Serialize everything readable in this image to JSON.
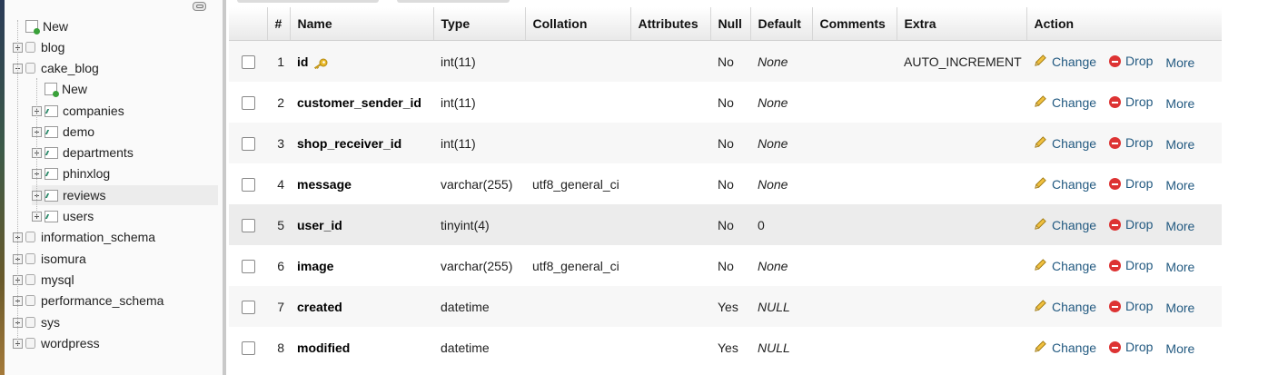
{
  "nav": {
    "items": [
      {
        "label": "New",
        "kind": "new",
        "level": 0
      },
      {
        "label": "blog",
        "kind": "db",
        "level": 0,
        "expander": "plus"
      },
      {
        "label": "cake_blog",
        "kind": "db",
        "level": 0,
        "expander": "minus"
      },
      {
        "label": "New",
        "kind": "new",
        "level": 1
      },
      {
        "label": "companies",
        "kind": "table",
        "level": 1,
        "expander": "plus"
      },
      {
        "label": "demo",
        "kind": "table",
        "level": 1,
        "expander": "plus"
      },
      {
        "label": "departments",
        "kind": "table",
        "level": 1,
        "expander": "plus"
      },
      {
        "label": "phinxlog",
        "kind": "table",
        "level": 1,
        "expander": "plus"
      },
      {
        "label": "reviews",
        "kind": "table",
        "level": 1,
        "expander": "plus",
        "selected": true
      },
      {
        "label": "users",
        "kind": "table",
        "level": 1,
        "expander": "plus"
      },
      {
        "label": "information_schema",
        "kind": "db",
        "level": 0,
        "expander": "plus"
      },
      {
        "label": "isomura",
        "kind": "db",
        "level": 0,
        "expander": "plus"
      },
      {
        "label": "mysql",
        "kind": "db",
        "level": 0,
        "expander": "plus"
      },
      {
        "label": "performance_schema",
        "kind": "db",
        "level": 0,
        "expander": "plus"
      },
      {
        "label": "sys",
        "kind": "db",
        "level": 0,
        "expander": "plus"
      },
      {
        "label": "wordpress",
        "kind": "db",
        "level": 0,
        "expander": "plus"
      }
    ]
  },
  "table": {
    "headers": {
      "num": "#",
      "name": "Name",
      "type": "Type",
      "collation": "Collation",
      "attributes": "Attributes",
      "null": "Null",
      "default": "Default",
      "comments": "Comments",
      "extra": "Extra",
      "action": "Action"
    },
    "action_labels": {
      "change": "Change",
      "drop": "Drop",
      "more": "More"
    },
    "rows": [
      {
        "num": "1",
        "name": "id",
        "type": "int(11)",
        "collation": "",
        "attributes": "",
        "null": "No",
        "default": "None",
        "default_italic": true,
        "comments": "",
        "extra": "AUTO_INCREMENT",
        "primary_key": true
      },
      {
        "num": "2",
        "name": "customer_sender_id",
        "type": "int(11)",
        "collation": "",
        "attributes": "",
        "null": "No",
        "default": "None",
        "default_italic": true,
        "comments": "",
        "extra": ""
      },
      {
        "num": "3",
        "name": "shop_receiver_id",
        "type": "int(11)",
        "collation": "",
        "attributes": "",
        "null": "No",
        "default": "None",
        "default_italic": true,
        "comments": "",
        "extra": ""
      },
      {
        "num": "4",
        "name": "message",
        "type": "varchar(255)",
        "collation": "utf8_general_ci",
        "attributes": "",
        "null": "No",
        "default": "None",
        "default_italic": true,
        "comments": "",
        "extra": ""
      },
      {
        "num": "5",
        "name": "user_id",
        "type": "tinyint(4)",
        "collation": "",
        "attributes": "",
        "null": "No",
        "default": "0",
        "default_italic": false,
        "comments": "",
        "extra": ""
      },
      {
        "num": "6",
        "name": "image",
        "type": "varchar(255)",
        "collation": "utf8_general_ci",
        "attributes": "",
        "null": "No",
        "default": "None",
        "default_italic": true,
        "comments": "",
        "extra": ""
      },
      {
        "num": "7",
        "name": "created",
        "type": "datetime",
        "collation": "",
        "attributes": "",
        "null": "Yes",
        "default": "NULL",
        "default_italic": true,
        "comments": "",
        "extra": ""
      },
      {
        "num": "8",
        "name": "modified",
        "type": "datetime",
        "collation": "",
        "attributes": "",
        "null": "Yes",
        "default": "NULL",
        "default_italic": true,
        "comments": "",
        "extra": ""
      }
    ]
  },
  "colors": {
    "link": "#235a81",
    "drop": "#dd3333",
    "key": "#e0b020"
  }
}
